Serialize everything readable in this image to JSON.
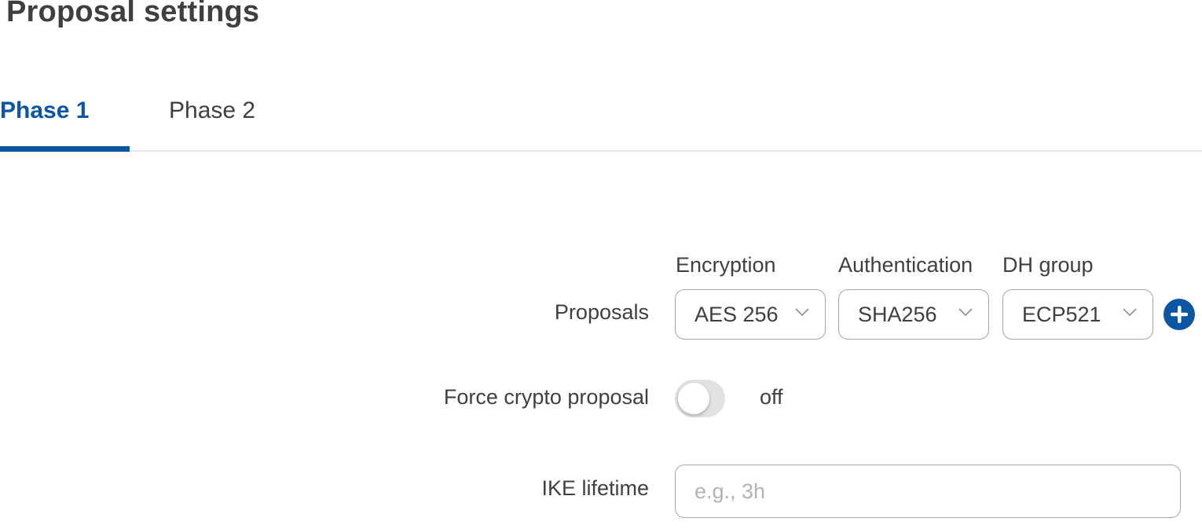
{
  "page": {
    "title": "Proposal settings"
  },
  "tabs": [
    {
      "label": "Phase 1",
      "active": true
    },
    {
      "label": "Phase 2",
      "active": false
    }
  ],
  "colors": {
    "accent": "#0a55a4",
    "toggle_off": "#e2e2e2",
    "border": "#a4a6aa",
    "placeholder": "#b3b3b3"
  },
  "form": {
    "proposals": {
      "label": "Proposals",
      "columns": {
        "encryption": "Encryption",
        "authentication": "Authentication",
        "dh_group": "DH group"
      },
      "encryption_value": "AES 256",
      "authentication_value": "SHA256",
      "dh_group_value": "ECP521",
      "add_icon": "plus-circle-icon"
    },
    "force_crypto_proposal": {
      "label": "Force crypto proposal",
      "state": "off"
    },
    "ike_lifetime": {
      "label": "IKE lifetime",
      "value": "",
      "placeholder": "e.g., 3h"
    }
  }
}
